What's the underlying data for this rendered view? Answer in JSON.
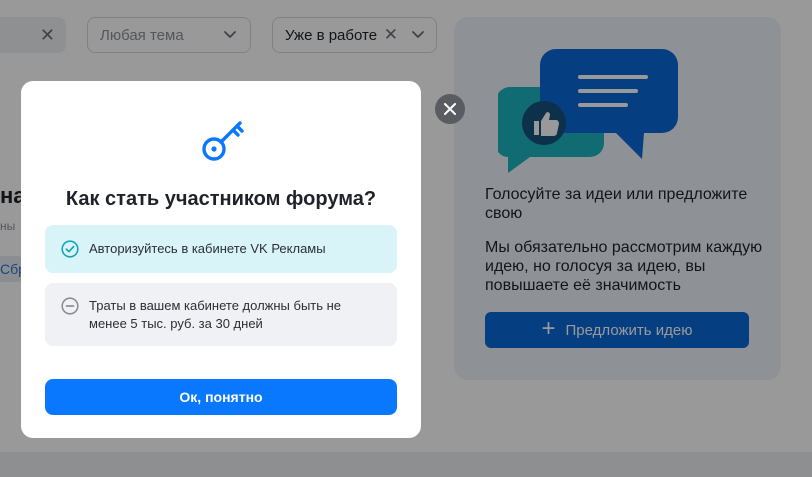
{
  "filters": {
    "theme_placeholder": "Любая тема",
    "status_value": "Уже в работе"
  },
  "background": {
    "left_heading_fragment": "на",
    "left_sub_fragment": "ны",
    "left_tag_fragment": "Сбр"
  },
  "side_card": {
    "heading": "Голосуйте за идеи или предложите свою",
    "text": "Мы обязательно рассмотрим каждую идею, но голосуя за идею, вы повышаете её значимость",
    "button_label": "Предложить идею",
    "colors": {
      "accent": "#0a6ad8",
      "bubble_dark": "#0a6ad8",
      "bubble_teal": "#1bb3bf"
    }
  },
  "modal": {
    "icon": "key-icon",
    "title": "Как стать участником форума?",
    "requirements": [
      {
        "icon": "check-circle-icon",
        "text": "Авторизуйтесь в кабинете VK Рекламы",
        "status": "done"
      },
      {
        "icon": "minus-circle-icon",
        "text": "Траты в вашем кабинете должны быть не менее 5 тыс. руб. за 30 дней",
        "status": "pending"
      }
    ],
    "ok_label": "Ок, понятно",
    "colors": {
      "primary": "#0a77ff",
      "done_bg": "#d9f4f8",
      "done_icon": "#13a6b6",
      "pending_bg": "#f0f1f4",
      "pending_icon": "#8a8f96"
    }
  },
  "close_icon": "close-icon"
}
